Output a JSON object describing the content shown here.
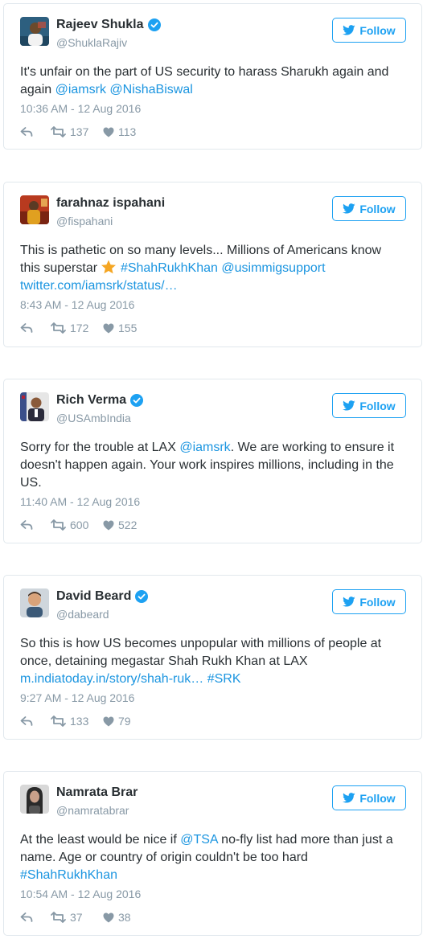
{
  "follow_label": "Follow",
  "colors": {
    "link": "#1b95e0",
    "muted": "#8899a6",
    "verified": "#1da1f2",
    "text": "#292f33"
  },
  "tweets": [
    {
      "name": "Rajeev Shukla",
      "verified": true,
      "handle": "@ShuklaRajiv",
      "text": {
        "p1": "It's unfair on the part of US security to harass Sharukh again and again ",
        "m1": "@iamsrk",
        "s1": " ",
        "m2": "@NishaBiswal"
      },
      "timestamp": "10:36 AM - 12 Aug 2016",
      "retweets": "137",
      "likes": "113"
    },
    {
      "name": "farahnaz ispahani",
      "verified": false,
      "handle": "@fispahani",
      "text": {
        "p1": "This is pathetic on so many levels... Millions of Americans know this superstar ",
        "emoji": "star-emoji",
        "s1": " ",
        "h1": "#ShahRukhKhan",
        "s2": " ",
        "m1": "@usimmigsupport",
        "l1": "twitter.com/iamsrk/status/…"
      },
      "timestamp": "8:43 AM - 12 Aug 2016",
      "retweets": "172",
      "likes": "155"
    },
    {
      "name": "Rich Verma",
      "verified": true,
      "handle": "@USAmbIndia",
      "text": {
        "p1": "Sorry for the trouble at LAX ",
        "m1": "@iamsrk",
        "p2": ". We are working to ensure it doesn't happen again. Your work inspires millions, including in the US."
      },
      "timestamp": "11:40 AM - 12 Aug 2016",
      "retweets": "600",
      "likes": "522"
    },
    {
      "name": "David Beard",
      "verified": true,
      "handle": "@dabeard",
      "text": {
        "p1": "So this is how US becomes unpopular with millions of people at once, detaining megastar Shah Rukh Khan at LAX",
        "l1": "m.indiatoday.in/story/shah-ruk…",
        "s1": " ",
        "h1": "#SRK"
      },
      "timestamp": "9:27 AM - 12 Aug 2016",
      "retweets": "133",
      "likes": "79"
    },
    {
      "name": "Namrata Brar",
      "verified": false,
      "handle": "@namratabrar",
      "text": {
        "p1": "At the least would be nice if ",
        "m1": "@TSA",
        "p2": " no-fly list had more than just a name. Age or country of origin couldn't be too hard",
        "h1": "#ShahRukhKhan"
      },
      "timestamp": "10:54 AM - 12 Aug 2016",
      "retweets": "37",
      "likes": "38"
    }
  ]
}
